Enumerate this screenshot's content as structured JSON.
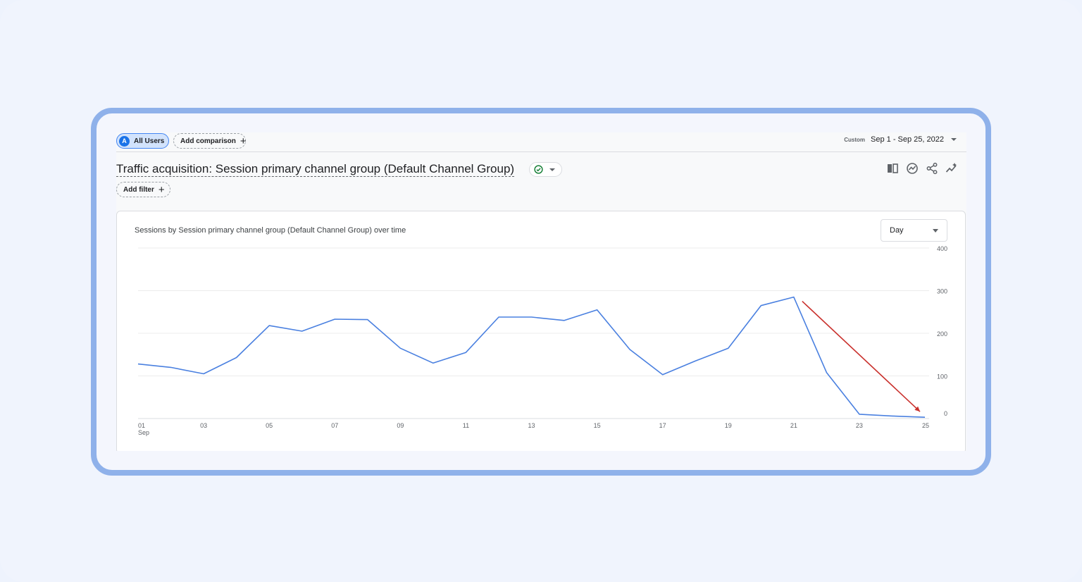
{
  "header": {
    "segment_avatar": "A",
    "segment_label": "All Users",
    "add_comparison_label": "Add comparison",
    "plus_glyph": "+",
    "date_label": "Custom",
    "date_range": "Sep 1 - Sep 25, 2022"
  },
  "report": {
    "title": "Traffic acquisition: Session primary channel group (Default Channel Group)",
    "add_filter_label": "Add filter",
    "status_icon": "check-circle-icon",
    "actions": [
      "compare-columns-icon",
      "insights-icon",
      "share-icon",
      "anomaly-icon"
    ]
  },
  "chart_card": {
    "day_select": "Day"
  },
  "colors": {
    "series_line": "#4a80e0",
    "annotation_arrow": "#c9302c",
    "status_green": "#188038",
    "accent": "#1a73e8"
  },
  "chart_data": {
    "type": "line",
    "title": "Sessions by Session primary channel group (Default Channel Group) over time",
    "x": [
      "01",
      "02",
      "03",
      "04",
      "05",
      "06",
      "07",
      "08",
      "09",
      "10",
      "11",
      "12",
      "13",
      "14",
      "15",
      "16",
      "17",
      "18",
      "19",
      "20",
      "21",
      "22",
      "23",
      "24",
      "25"
    ],
    "x_tick_labels": [
      "01",
      "03",
      "05",
      "07",
      "09",
      "11",
      "13",
      "15",
      "17",
      "19",
      "21",
      "23",
      "25"
    ],
    "x_month_label": "Sep",
    "series": [
      {
        "values": [
          128,
          120,
          105,
          143,
          218,
          205,
          233,
          232,
          165,
          130,
          155,
          238,
          238,
          230,
          255,
          162,
          103,
          135,
          165,
          265,
          285,
          108,
          10,
          6,
          3
        ]
      }
    ],
    "ylim": [
      0,
      400
    ],
    "y_ticks": [
      "0",
      "100",
      "200",
      "300",
      "400"
    ],
    "grid": true,
    "annotation": {
      "type": "arrow",
      "from_x": "21",
      "to_x": "25",
      "color": "#c9302c"
    }
  }
}
